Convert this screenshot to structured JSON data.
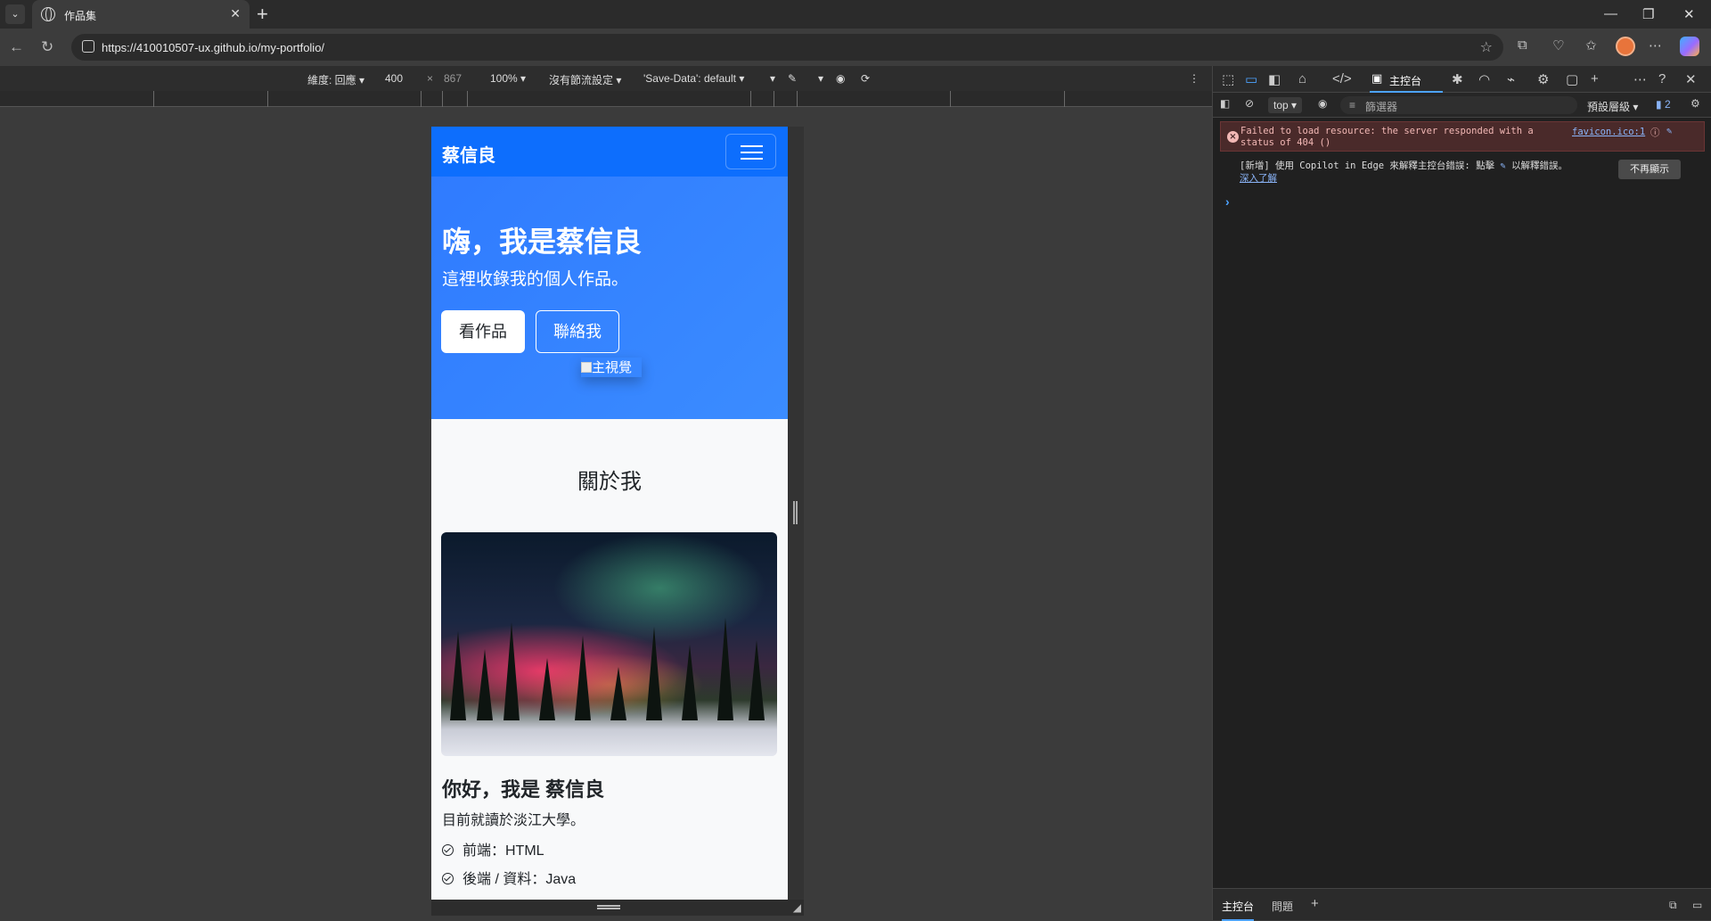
{
  "browser": {
    "tab_title": "作品集",
    "url": "https://410010507-ux.github.io/my-portfolio/"
  },
  "device_toolbar": {
    "dimensions_label": "維度: 回應",
    "width": "400",
    "times": "×",
    "height": "867",
    "zoom": "100%",
    "throttling": "沒有節流設定",
    "save_data": "'Save-Data': default"
  },
  "site": {
    "brand": "蔡信良",
    "hero": {
      "heading": "嗨，我是蔡信良",
      "subheading": "這裡收錄我的個人作品。",
      "primary_button": "看作品",
      "secondary_button": "聯絡我",
      "image_alt": "主視覺"
    },
    "about": {
      "section_title": "關於我",
      "heading": "你好，我是 蔡信良",
      "description": "目前就讀於淡江大學。",
      "skills": [
        "前端：HTML",
        "後端 / 資料：Java"
      ]
    }
  },
  "devtools": {
    "console_tab": "主控台",
    "context": "top",
    "filter_placeholder": "篩選器",
    "levels": "預設層級",
    "issues_count": "2",
    "error_message": "Failed to load resource: the server responded with a status of 404 ()",
    "error_source": "favicon.ico:1",
    "copilot_message": "[新增] 使用 Copilot in Edge 來解釋主控台錯誤: 點擊",
    "copilot_message_tail": "以解釋錯誤。",
    "learn_more": "深入了解",
    "dismiss": "不再顯示",
    "drawer_tabs": [
      "主控台",
      "問題"
    ]
  },
  "colors": {
    "site_primary": "#0d6efd",
    "hero_gradient": "#3b8cff",
    "error_bg": "#4a2a2a"
  }
}
